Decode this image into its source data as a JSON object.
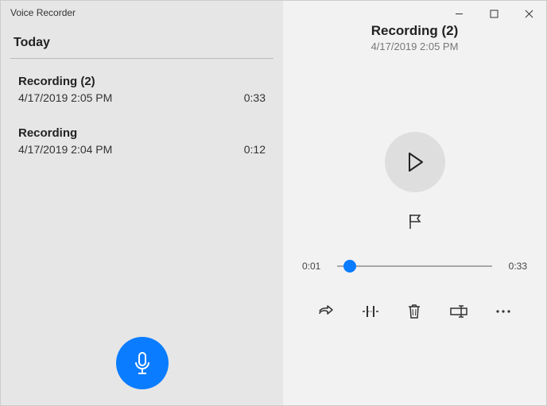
{
  "app": {
    "title": "Voice Recorder"
  },
  "sidebar": {
    "group_label": "Today",
    "items": [
      {
        "name": "Recording (2)",
        "date": "4/17/2019 2:05 PM",
        "duration": "0:33"
      },
      {
        "name": "Recording",
        "date": "4/17/2019 2:04 PM",
        "duration": "0:12"
      }
    ]
  },
  "detail": {
    "title": "Recording (2)",
    "date": "4/17/2019 2:05 PM",
    "elapsed": "0:01",
    "total": "0:33",
    "progress_percent": 8
  },
  "icons": {
    "record": "microphone-icon",
    "play": "play-icon",
    "flag": "flag-icon",
    "share": "share-icon",
    "trim": "trim-icon",
    "delete": "trash-icon",
    "rename": "rename-icon",
    "more": "more-icon"
  },
  "window_controls": {
    "minimize": "—",
    "maximize": "□",
    "close": "✕"
  }
}
